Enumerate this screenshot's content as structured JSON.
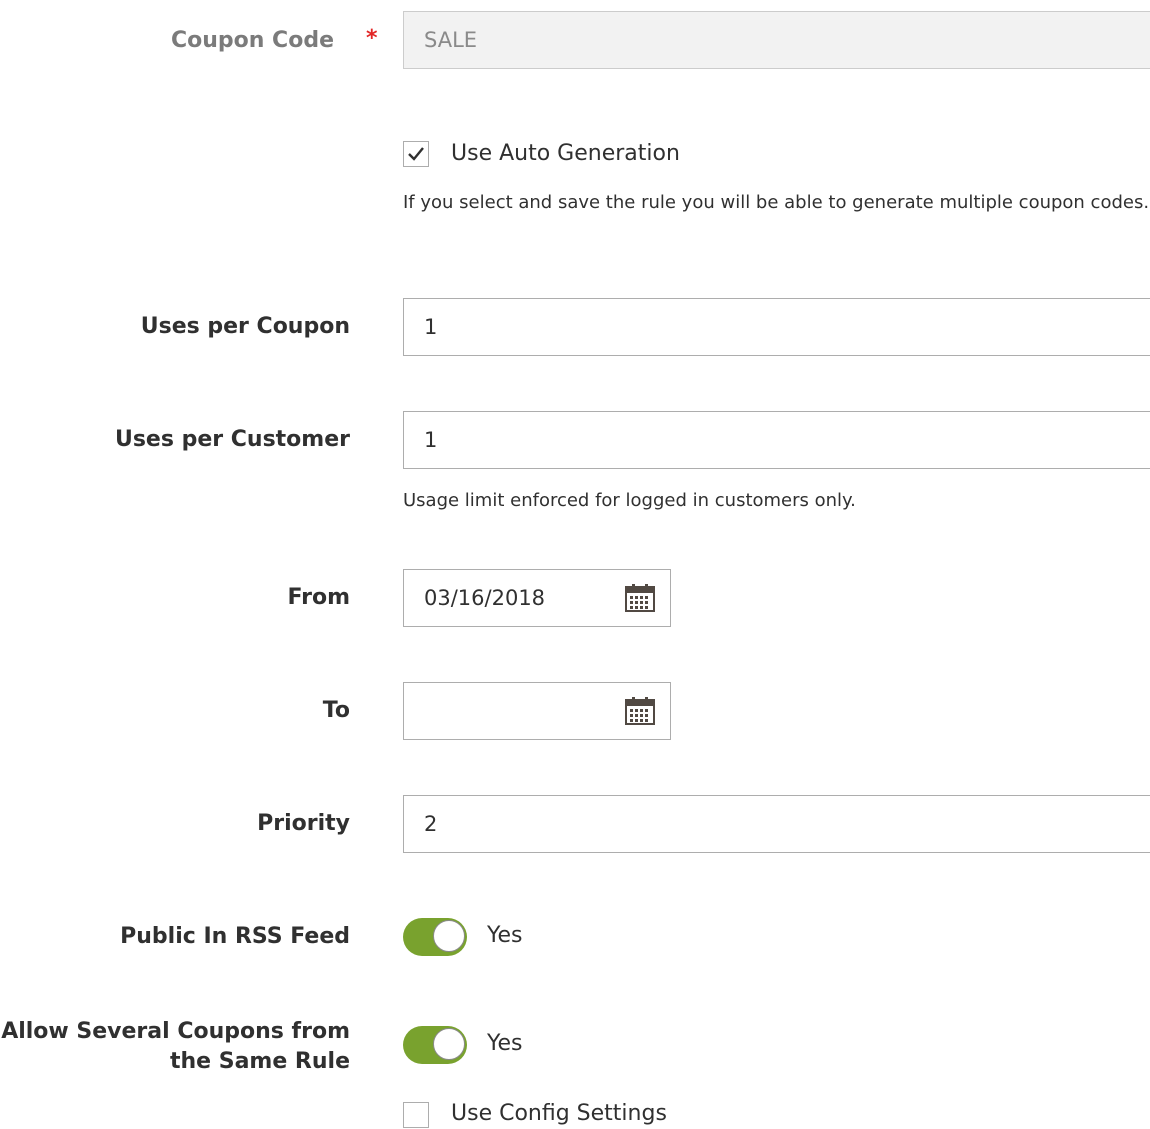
{
  "colors": {
    "toggle_on": "#79a22e",
    "required": "#e22626"
  },
  "coupon_code": {
    "label": "Coupon Code",
    "required_mark": "*",
    "value": "SALE"
  },
  "auto_generation": {
    "label": "Use Auto Generation",
    "checked": true,
    "note": "If you select and save the rule you will be able to generate multiple coupon codes."
  },
  "uses_per_coupon": {
    "label": "Uses per Coupon",
    "value": "1"
  },
  "uses_per_customer": {
    "label": "Uses per Customer",
    "value": "1",
    "note": "Usage limit enforced for logged in customers only."
  },
  "from": {
    "label": "From",
    "value": "03/16/2018",
    "icon": "calendar-icon"
  },
  "to": {
    "label": "To",
    "value": "",
    "icon": "calendar-icon"
  },
  "priority": {
    "label": "Priority",
    "value": "2"
  },
  "public_in_rss": {
    "label": "Public In RSS Feed",
    "state": "Yes",
    "on": true
  },
  "allow_several": {
    "label_line1": "Allow Several Coupons from",
    "label_line2": "the Same Rule",
    "state": "Yes",
    "on": true
  },
  "use_config": {
    "label": "Use Config Settings",
    "checked": false
  }
}
